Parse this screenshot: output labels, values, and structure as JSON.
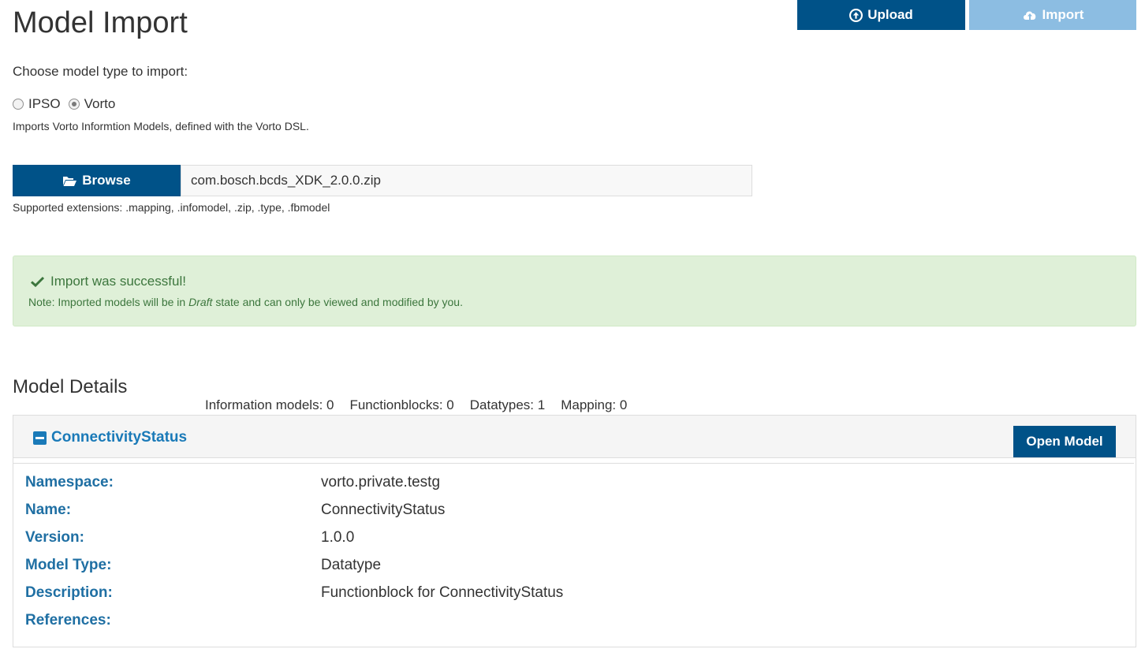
{
  "page": {
    "title": "Model Import"
  },
  "toolbar": {
    "upload_label": "Upload",
    "upload_icon": "circle-arrow-up-icon",
    "import_label": "Import",
    "import_icon": "cloud-upload-icon"
  },
  "model_type": {
    "prompt": "Choose model type to import:",
    "options": [
      {
        "label": "IPSO",
        "selected": false
      },
      {
        "label": "Vorto",
        "selected": true
      }
    ],
    "description": "Imports Vorto Informtion Models, defined with the Vorto DSL."
  },
  "file": {
    "browse_label": "Browse",
    "browse_icon": "folder-open-icon",
    "filename": "com.bosch.bcds_XDK_2.0.0.zip",
    "supported_extensions": "Supported extensions: .mapping, .infomodel, .zip, .type, .fbmodel"
  },
  "alert": {
    "icon": "check-icon",
    "title": "Import was successful!",
    "note_prefix": "Note: Imported models will be in ",
    "note_emphasis": "Draft",
    "note_suffix": " state and can only be viewed and modified by you.",
    "colors": {
      "background": "#dff0d8",
      "text": "#3c763d"
    }
  },
  "model_details": {
    "heading": "Model Details",
    "counts": [
      "Information models: 0",
      "Functionblocks: 0",
      "Datatypes: 1",
      "Mapping: 0"
    ],
    "model": {
      "name": "ConnectivityStatus",
      "collapse_icon": "minus-square-icon",
      "open_label": "Open Model",
      "fields": [
        {
          "label": "Namespace:",
          "value": "vorto.private.testg"
        },
        {
          "label": "Name:",
          "value": "ConnectivityStatus"
        },
        {
          "label": "Version:",
          "value": "1.0.0"
        },
        {
          "label": "Model Type:",
          "value": "Datatype"
        },
        {
          "label": "Description:",
          "value": "Functionblock for ConnectivityStatus"
        },
        {
          "label": "References:",
          "value": ""
        }
      ]
    }
  },
  "colors": {
    "primary": "#005288",
    "primary_disabled": "#8cbde2",
    "link": "#1a7ab8"
  }
}
